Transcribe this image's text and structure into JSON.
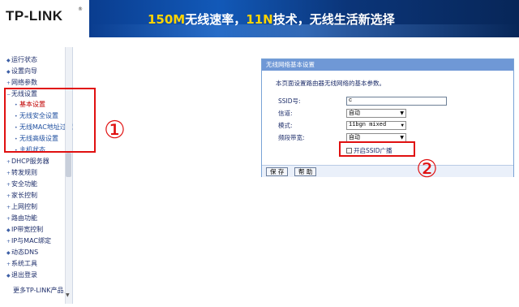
{
  "header": {
    "logo": "TP-LINK",
    "logo_mark": "®",
    "slogan_highlight_1": "150M",
    "slogan_part_1": "无线速率，",
    "slogan_highlight_2": "11N",
    "slogan_part_2": "技术，无线生活新选择"
  },
  "sidebar": {
    "items": [
      {
        "label": "运行状态"
      },
      {
        "label": "设置向导"
      },
      {
        "label": "网络参数"
      },
      {
        "label": "无线设置"
      },
      {
        "label": "基本设置"
      },
      {
        "label": "无线安全设置"
      },
      {
        "label": "无线MAC地址过滤"
      },
      {
        "label": "无线高级设置"
      },
      {
        "label": "主机状态"
      },
      {
        "label": "DHCP服务器"
      },
      {
        "label": "转发规则"
      },
      {
        "label": "安全功能"
      },
      {
        "label": "家长控制"
      },
      {
        "label": "上网控制"
      },
      {
        "label": "路由功能"
      },
      {
        "label": "IP带宽控制"
      },
      {
        "label": "IP与MAC绑定"
      },
      {
        "label": "动态DNS"
      },
      {
        "label": "系统工具"
      },
      {
        "label": "退出登录"
      }
    ],
    "more": "更多TP-LINK产品，"
  },
  "panel": {
    "title": "无线网络基本设置",
    "description": "本页面设置路由器无线网络的基本参数。",
    "ssid_label": "SSID号:",
    "ssid_value": "c",
    "channel_label": "信道:",
    "channel_value": "自动",
    "mode_label": "模式:",
    "mode_value": "11bgn mixed",
    "bandwidth_label": "频段带宽:",
    "bandwidth_value": "自动",
    "ssid_broadcast_label": "开启SSID广播",
    "ssid_broadcast_checked": false,
    "save_label": "保 存",
    "help_label": "帮 助"
  },
  "annotations": {
    "one": "①",
    "two": "②"
  },
  "colors": {
    "panel_title_bg": "#6f98d6",
    "annotation": "#e01010",
    "header_bg": "#0a2a6e"
  }
}
